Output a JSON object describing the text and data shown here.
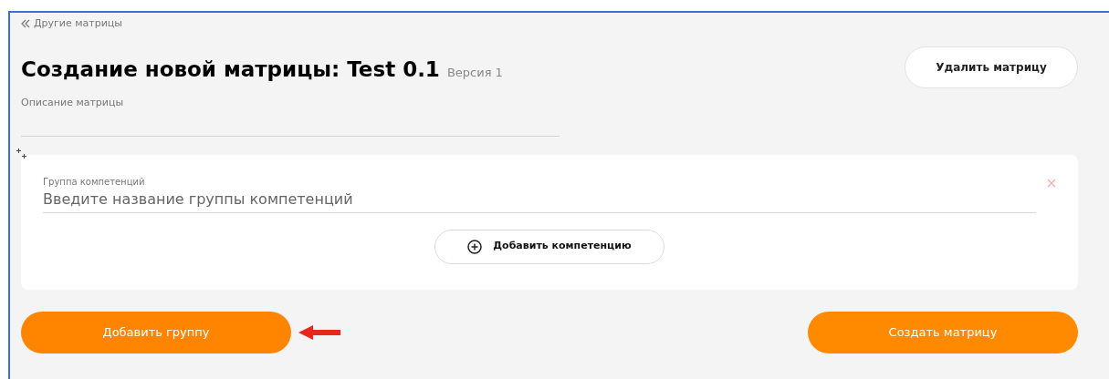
{
  "back_link": {
    "label": "Другие матрицы"
  },
  "header": {
    "title": "Создание новой матрицы: Test 0.1",
    "version": "Версия 1",
    "delete_button": "Удалить матрицу"
  },
  "description_field": {
    "label": "Описание матрицы"
  },
  "groups": [
    {
      "label": "Группа компетенций",
      "placeholder": "Введите название группы компетенций",
      "add_button": "Добавить компетенцию"
    }
  ],
  "actions": {
    "add_group": "Добавить группу",
    "create": "Создать матрицу"
  }
}
